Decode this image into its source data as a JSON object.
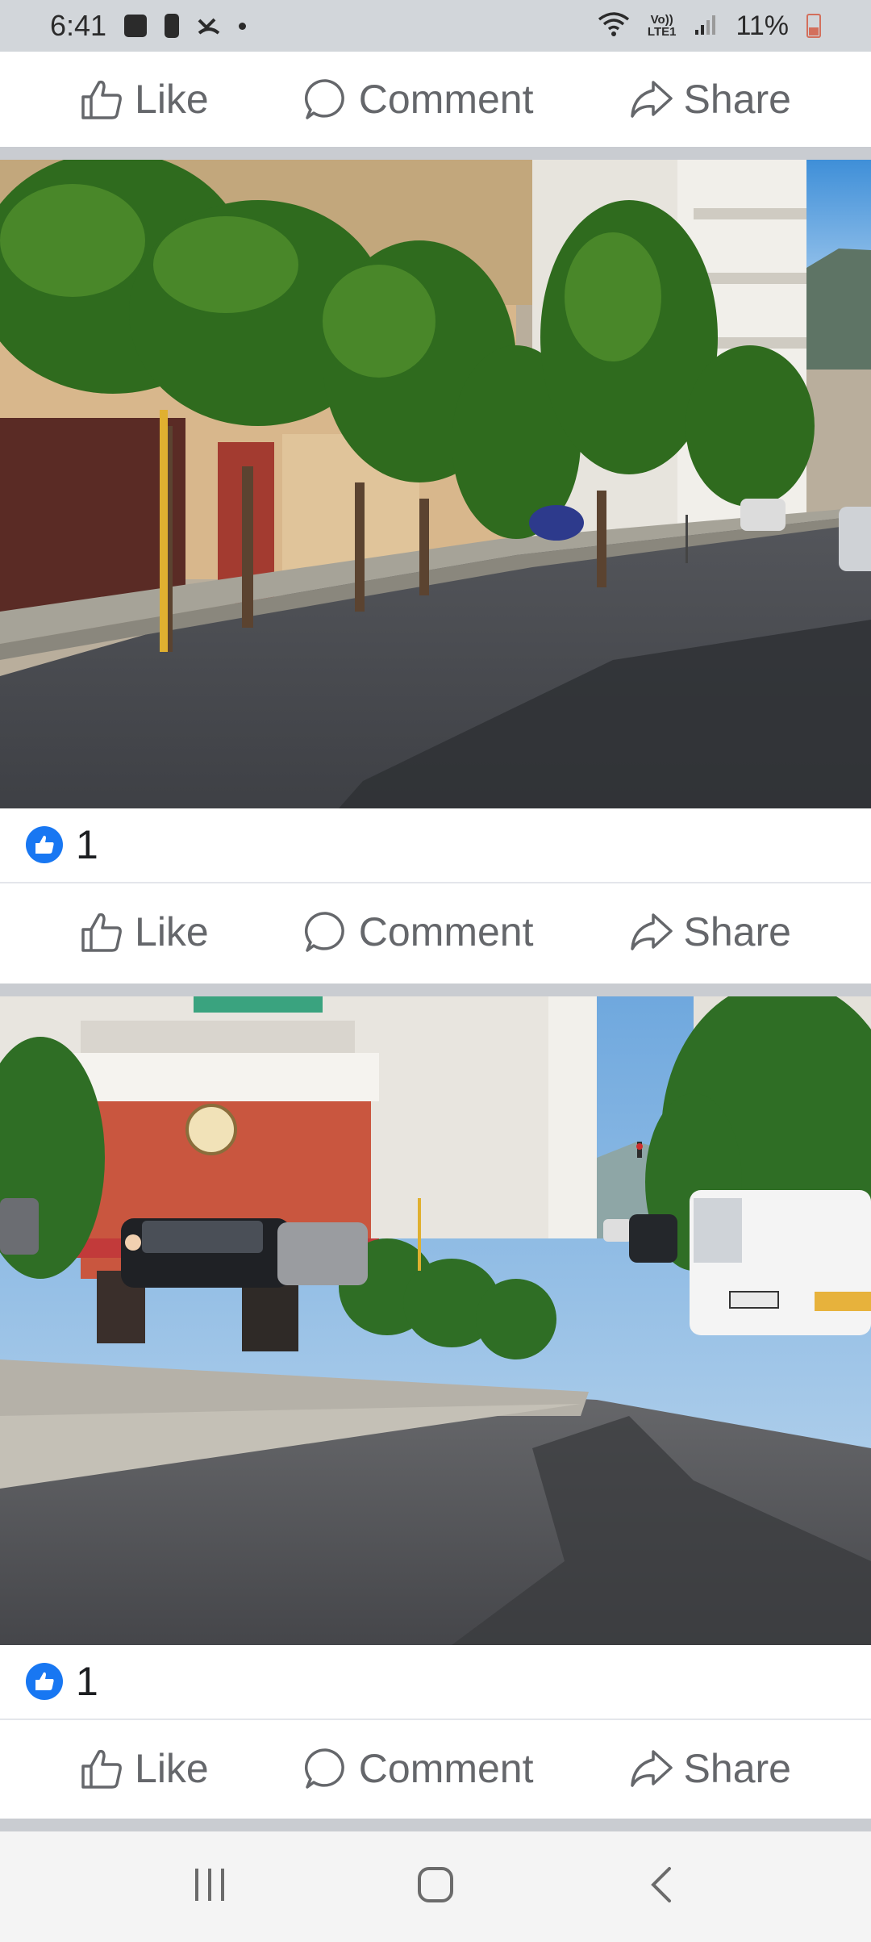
{
  "status_bar": {
    "time": "6:41",
    "network_label_top": "Vo))",
    "network_label_bottom": "LTE1",
    "battery": "11%"
  },
  "actions": {
    "like": "Like",
    "comment": "Comment",
    "share": "Share"
  },
  "posts": [
    {
      "reaction_count": "1"
    },
    {
      "reaction_count": "1"
    }
  ],
  "colors": {
    "accent": "#1877f2",
    "action_text": "#65676b",
    "status_bar_bg": "#d2d6da",
    "separator": "#c9ccd1",
    "battery_low": "#d36f5c"
  },
  "icons": [
    "photo-icon",
    "sim-icon",
    "missed-call-icon",
    "notification-dot-icon",
    "wifi-icon",
    "signal-icon",
    "battery-icon",
    "thumbs-up-icon",
    "comment-icon",
    "share-icon",
    "recent-apps-icon",
    "home-icon",
    "back-icon"
  ]
}
